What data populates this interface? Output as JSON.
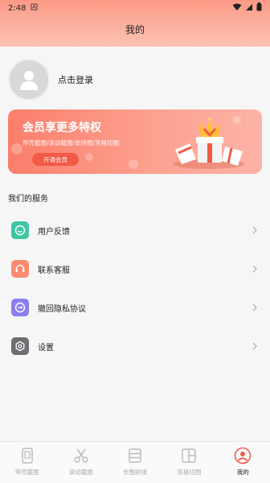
{
  "status_bar": {
    "time": "2:48"
  },
  "header": {
    "title": "我的"
  },
  "profile": {
    "login_text": "点击登录"
  },
  "vip": {
    "title": "会员享更多特权",
    "subtitle": "带壳截图/滚动截图/长拼图/宫格切图",
    "button": "开通会员"
  },
  "services": {
    "title": "我们的服务",
    "items": [
      {
        "label": "用户反馈",
        "icon": "feedback-icon",
        "color": "#3ec6a3"
      },
      {
        "label": "联系客服",
        "icon": "customer-service-icon",
        "color": "#fb8a6e"
      },
      {
        "label": "撤回隐私协议",
        "icon": "privacy-icon",
        "color": "#8a7ef0"
      },
      {
        "label": "设置",
        "icon": "settings-icon",
        "color": "#6e6e72"
      }
    ]
  },
  "tabbar": {
    "items": [
      {
        "label": "带壳截图",
        "icon": "phone-frame-icon"
      },
      {
        "label": "滚动截图",
        "icon": "scroll-capture-icon"
      },
      {
        "label": "长图拼接",
        "icon": "long-stitch-icon"
      },
      {
        "label": "宫格切图",
        "icon": "grid-cut-icon"
      },
      {
        "label": "我的",
        "icon": "profile-icon"
      }
    ],
    "active_index": 4
  }
}
